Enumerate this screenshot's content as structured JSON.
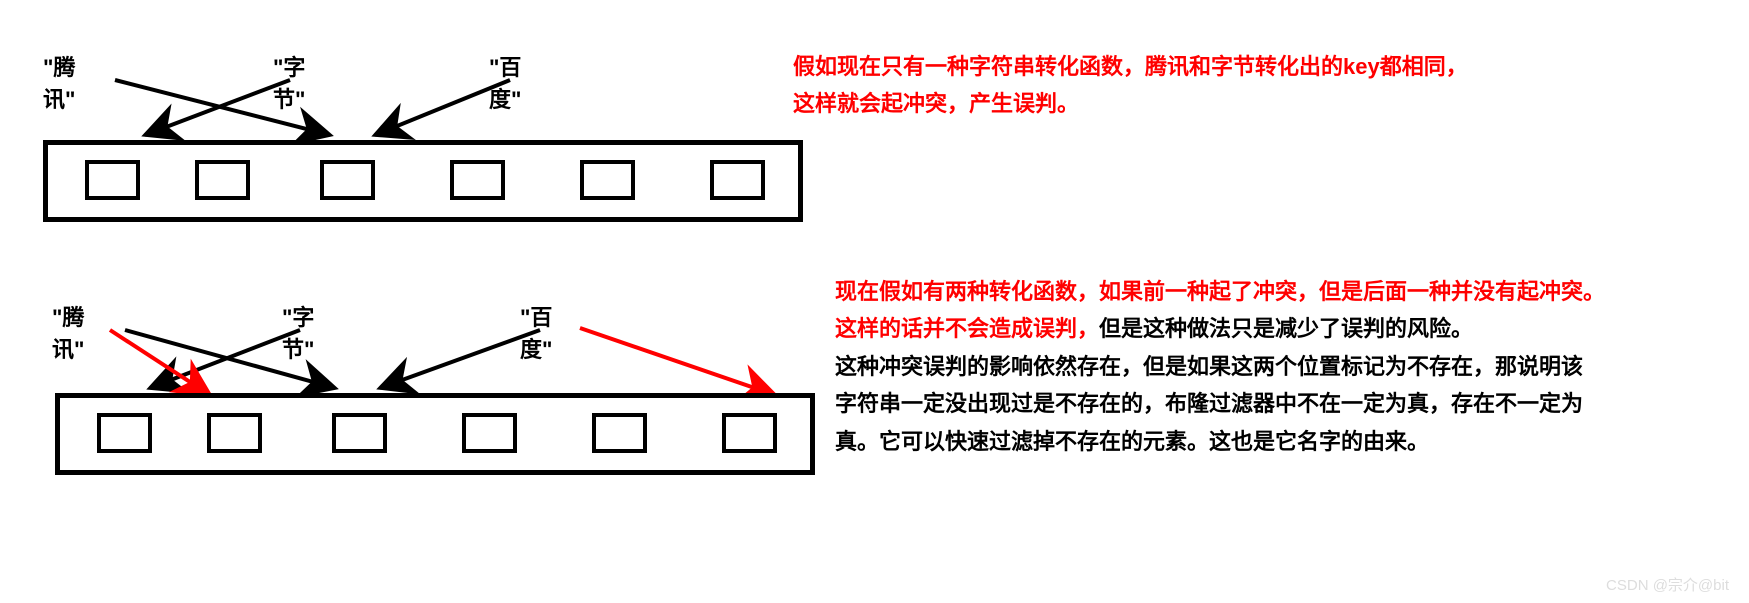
{
  "diagram1": {
    "labels": {
      "item1": "\"腾讯\"",
      "item2": "\"字节\"",
      "item3": "\"百度\""
    },
    "annotation": {
      "line1": "假如现在只有一种字符串转化函数，腾讯和字节转化出的key都相同，",
      "line2": "这样就会起冲突，产生误判。"
    }
  },
  "diagram2": {
    "labels": {
      "item1": "\"腾讯\"",
      "item2": "\"字节\"",
      "item3": "\"百度\""
    },
    "annotation": {
      "line1_red": "现在假如有两种转化函数，如果前一种起了冲突，但是后面一种并没有起冲突。",
      "line2_a_red": "这样的话并不会造成误判，",
      "line2_b_black": "但是这种做法只是减少了误判的风险。",
      "line3": "这种冲突误判的影响依然存在，但是如果这两个位置标记为不存在，那说明该",
      "line4": "字符串一定没出现过是不存在的，布隆过滤器中不在一定为真，存在不一定为",
      "line5": "真。它可以快速过滤掉不存在的元素。这也是它名字的由来。"
    }
  },
  "watermark": "CSDN @宗介@bit"
}
